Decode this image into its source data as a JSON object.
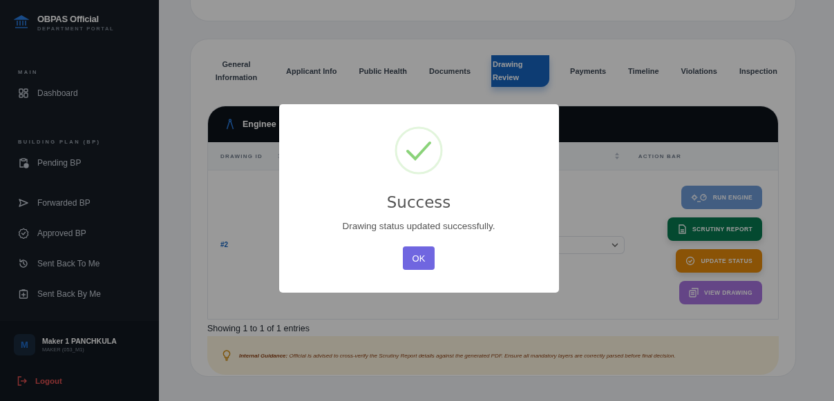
{
  "sidebar": {
    "brand": {
      "title": "OBPAS Official",
      "subtitle": "DEPARTMENT PORTAL"
    },
    "sections": [
      {
        "heading": "MAIN",
        "items": [
          {
            "label": "Dashboard",
            "kind": "grid",
            "selected": false
          }
        ]
      },
      {
        "heading": "BUILDING PLAN (BP)",
        "items": [
          {
            "label": "Pending BP",
            "kind": "clipboard",
            "selected": false
          },
          {
            "label": "Forwarded BP",
            "kind": "send",
            "selected": false
          },
          {
            "label": "Approved BP",
            "kind": "badge",
            "selected": false
          },
          {
            "label": "Sent Back To Me",
            "kind": "history",
            "selected": false
          },
          {
            "label": "Sent Back By Me",
            "kind": "plus",
            "selected": false
          }
        ]
      }
    ],
    "user": {
      "initial": "M",
      "name": "Maker 1 PANCHKULA",
      "role": "MAKER (053_M1)"
    },
    "logout": "Logout"
  },
  "tabs": [
    {
      "label": "General Information",
      "selected": false
    },
    {
      "label": "Applicant Info",
      "selected": false
    },
    {
      "label": "Public Health",
      "selected": false
    },
    {
      "label": "Documents",
      "selected": false
    },
    {
      "label": "Drawing Review",
      "selected": true
    },
    {
      "label": "Payments",
      "selected": false
    },
    {
      "label": "Timeline",
      "selected": false
    },
    {
      "label": "Violations",
      "selected": false
    },
    {
      "label": "Inspection",
      "selected": false
    }
  ],
  "table": {
    "title": "Enginee",
    "columns": [
      "DRAWING ID",
      "ACTION BAR"
    ],
    "rows": [
      {
        "id": "#2",
        "actions": [
          {
            "label": "RUN ENGINE",
            "kind": "engine",
            "disabled": true
          },
          {
            "label": "SCRUTINY REPORT",
            "kind": "report",
            "disabled": false
          },
          {
            "label": "UPDATE STATUS",
            "kind": "status",
            "disabled": false
          },
          {
            "label": "VIEW DRAWING",
            "kind": "view",
            "disabled": true
          }
        ]
      }
    ],
    "footer": "Showing 1 to 1 of 1 entries"
  },
  "guidance": "**Internal Guidance:** Official is advised to cross-verify the Scrutiny Report details against the generated PDF. Ensure all mandatory layers are correctly parsed before final decision.",
  "modal": {
    "title": "Success",
    "message": "Drawing status updated successfully.",
    "button": "OK"
  }
}
